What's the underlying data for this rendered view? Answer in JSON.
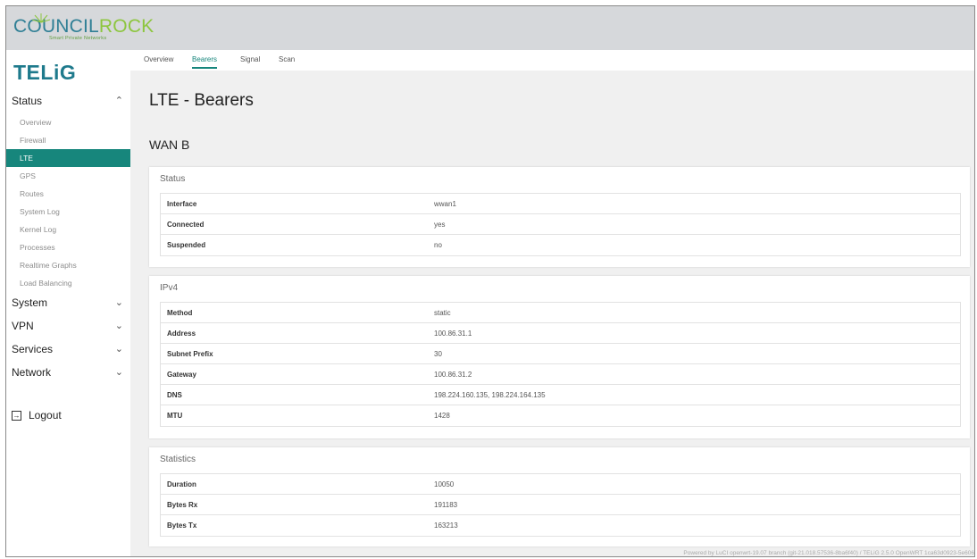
{
  "header": {
    "logo_part1": "COUNCIL",
    "logo_part2": "ROCK",
    "logo_sub": "Smart Private Networks",
    "colors": {
      "teal": "#2f7f95",
      "green": "#8dc63f"
    }
  },
  "sidebar": {
    "brand": "TELiG",
    "sections": [
      {
        "label": "Status",
        "chevron": "^"
      },
      {
        "label": "System",
        "chevron": "v"
      },
      {
        "label": "VPN",
        "chevron": "v"
      },
      {
        "label": "Services",
        "chevron": "v"
      },
      {
        "label": "Network",
        "chevron": "v"
      }
    ],
    "status_items": [
      "Overview",
      "Firewall",
      "LTE",
      "GPS",
      "Routes",
      "System Log",
      "Kernel Log",
      "Processes",
      "Realtime Graphs",
      "Load Balancing"
    ],
    "active_item": "LTE",
    "logout_label": "Logout",
    "active_color": "#17867c"
  },
  "tabs": [
    "Overview",
    "Bearers",
    "Signal",
    "Scan"
  ],
  "active_tab": "Bearers",
  "page": {
    "title": "LTE - Bearers",
    "section": "WAN B"
  },
  "cards": {
    "status": {
      "title": "Status",
      "rows": [
        {
          "key": "Interface",
          "value": "wwan1"
        },
        {
          "key": "Connected",
          "value": "yes"
        },
        {
          "key": "Suspended",
          "value": "no"
        }
      ]
    },
    "ipv4": {
      "title": "IPv4",
      "rows": [
        {
          "key": "Method",
          "value": "static"
        },
        {
          "key": "Address",
          "value": "100.86.31.1"
        },
        {
          "key": "Subnet Prefix",
          "value": "30"
        },
        {
          "key": "Gateway",
          "value": "100.86.31.2"
        },
        {
          "key": "DNS",
          "value": "198.224.160.135, 198.224.164.135"
        },
        {
          "key": "MTU",
          "value": "1428"
        }
      ]
    },
    "statistics": {
      "title": "Statistics",
      "rows": [
        {
          "key": "Duration",
          "value": "10050"
        },
        {
          "key": "Bytes Rx",
          "value": "191183"
        },
        {
          "key": "Bytes Tx",
          "value": "163213"
        }
      ]
    }
  },
  "footer": "Powered by LuCI openwrt-19.07 branch (git-21.018.57536-8ba6f40) / TELiG 2.5.0 OpenWRT 1ca63d0923-5e606"
}
